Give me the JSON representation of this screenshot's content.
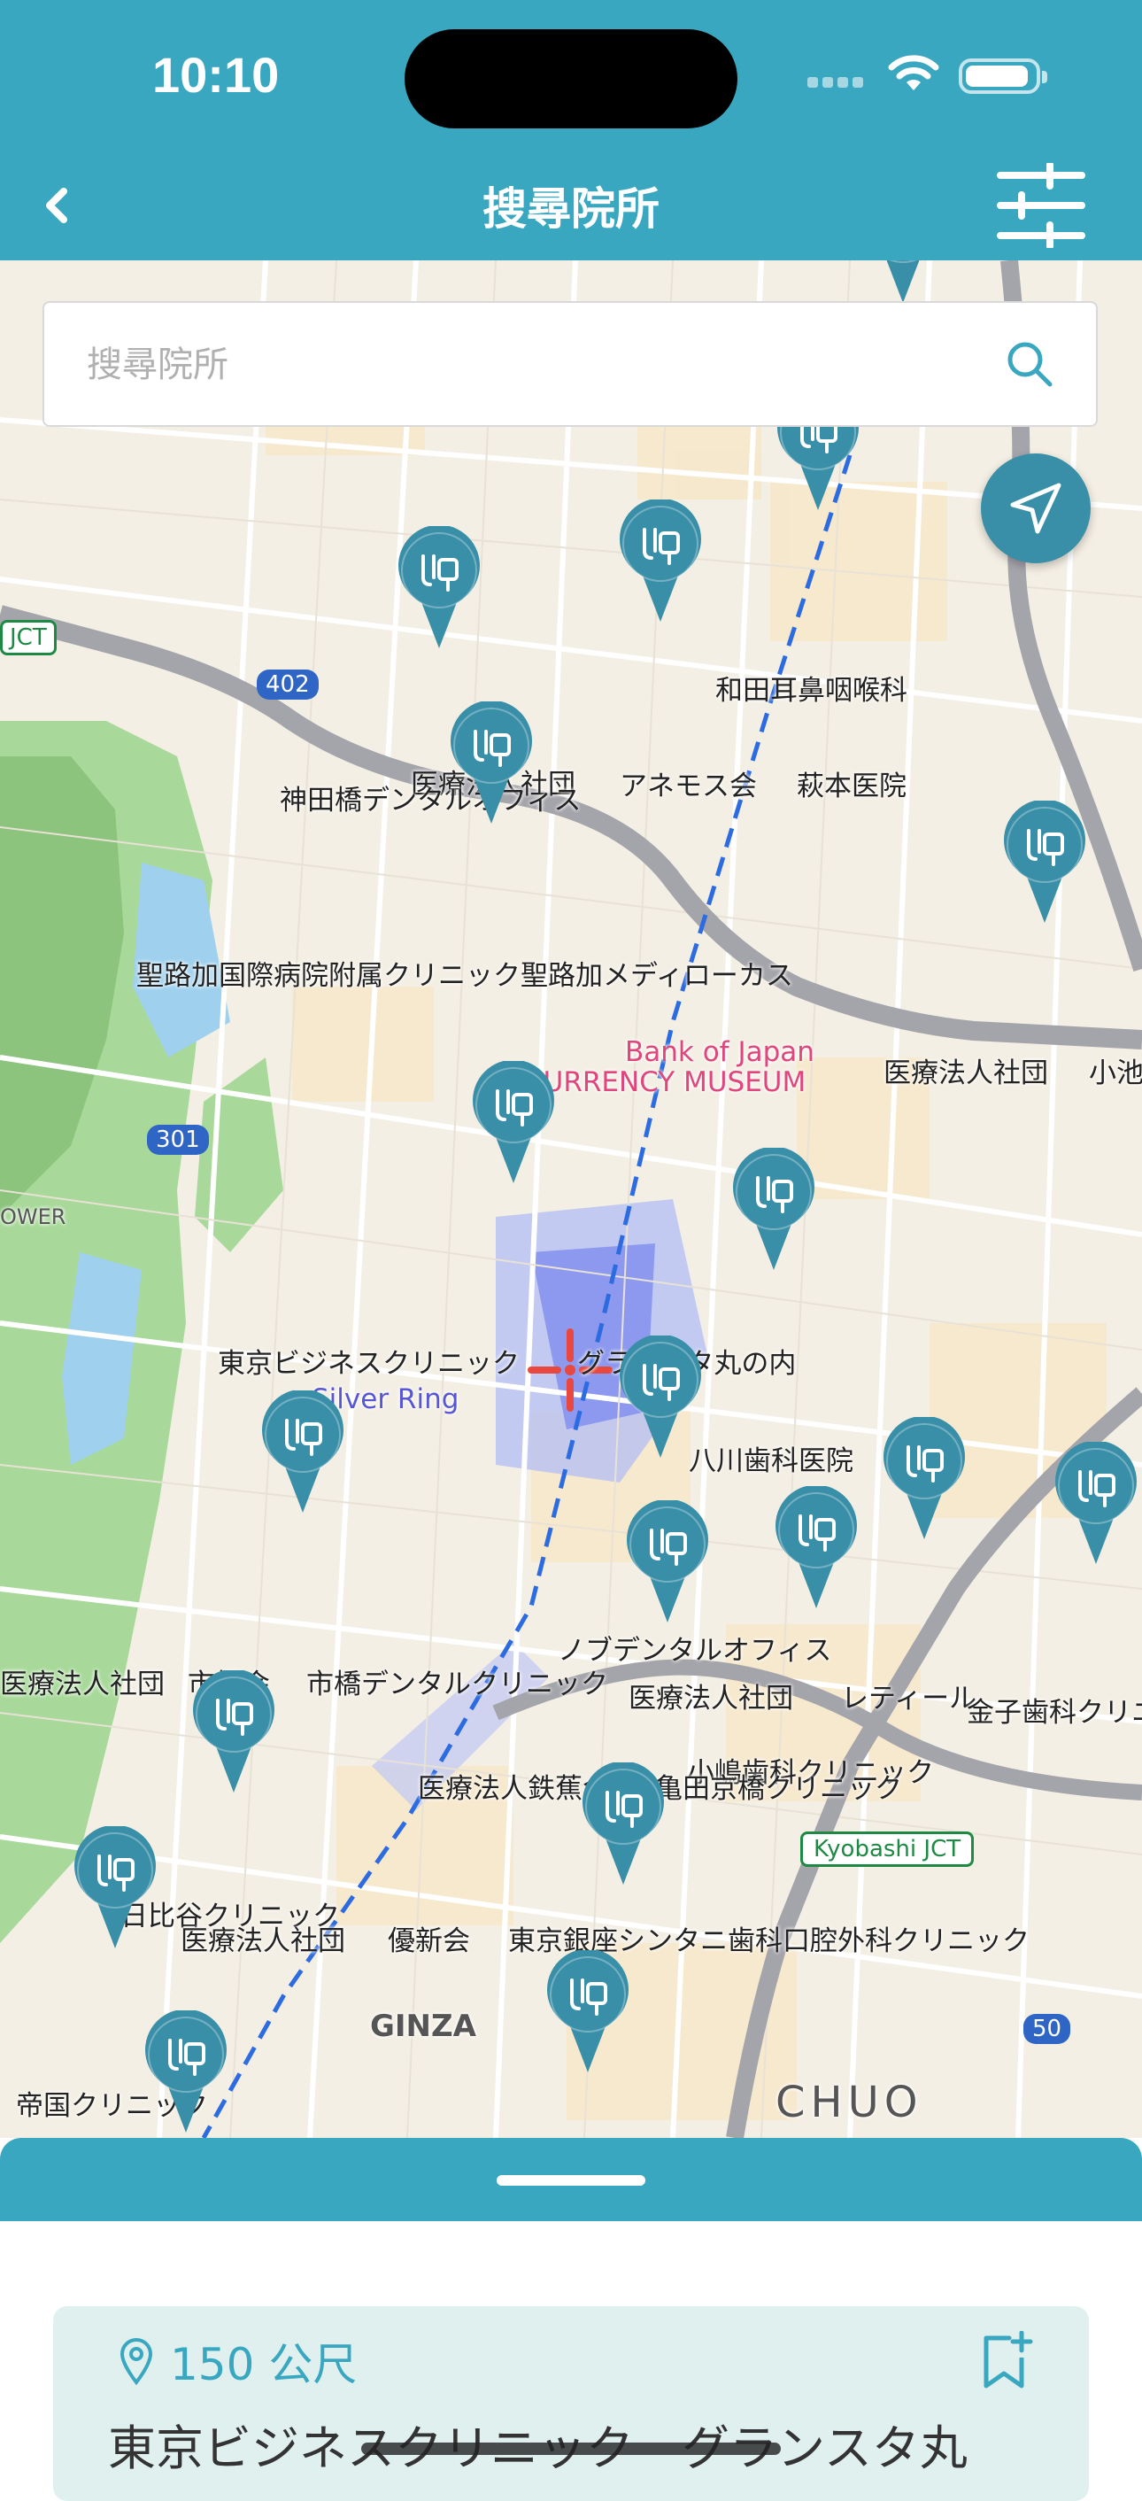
{
  "status_bar": {
    "time": "10:10"
  },
  "nav": {
    "title": "搜尋院所",
    "back_icon": "chevron-left-icon",
    "filter_icon": "sliders-icon"
  },
  "search": {
    "placeholder": "搜尋院所",
    "value": ""
  },
  "map": {
    "labels": {
      "wada": "和田耳鼻咽喉科",
      "anemos": "アネモス会",
      "hagimoto": "萩本医院",
      "iryo1": "医療法人社団",
      "kandabashi": "神田橋デンタルオフィス",
      "seiroka": "聖路加国際病院附属クリニック聖路加メディローカス",
      "boj1": "Bank of Japan",
      "boj2": "CURRENCY MUSEUM",
      "iryo2": "医療法人社団",
      "kosai": "小池",
      "tokyo_business": "東京ビジネスクリニック",
      "gransta": "グランスタ丸の内",
      "silver_ring": "Silver Ring",
      "yakawa": "八川歯科医院",
      "iryo3": "医療法人社団",
      "ichihashi": "市橋会",
      "ichihashi_dental": "市橋デンタルクリニック",
      "nobuden": "ノブデンタルオフィス",
      "iryo4": "医療法人社団",
      "retiru": "レティール",
      "kaneko": "金子歯科クリニック",
      "kojima": "小嶋歯科クリニック",
      "iryo_tetsu": "医療法人鉄蕉会",
      "kameda": "亀田京橋クリニック",
      "hibiya": "日比谷クリニック",
      "iryo5": "医療法人社団",
      "yushin": "優新会",
      "tokyo_ginza": "東京銀座シンタニ歯科口腔外科クリニック",
      "ginza": "GINZA",
      "chuo": "CHUO",
      "teikoku": "帝国クリニック",
      "kyobashi_jct": "Kyobashi JCT",
      "jct": "JCT",
      "route402": "402",
      "route301": "301",
      "route50": "50",
      "tower": "OWER"
    }
  },
  "locate_icon": "location-arrow-icon",
  "sheet": {
    "distance": "150 公尺",
    "clinic_name": "東京ビジネスクリニック　グランスタ丸",
    "pin_icon": "map-pin-icon",
    "bookmark_icon": "bookmark-add-icon"
  },
  "colors": {
    "brand": "#3aa7c1",
    "pin": "#3a8fa8",
    "card_bg": "#dff0ef"
  }
}
